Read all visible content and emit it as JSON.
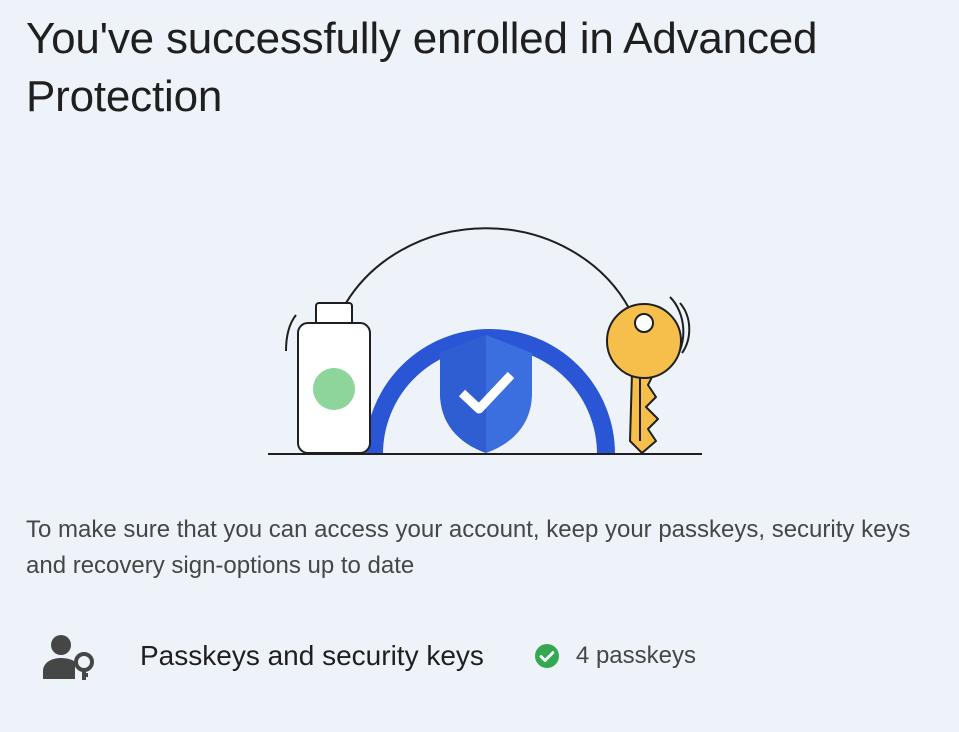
{
  "page": {
    "title": "You've successfully enrolled in Advanced Protection",
    "description": "To make sure that you can access your account, keep your passkeys, security keys and recovery sign-options up to date"
  },
  "illustration": {
    "icon": "advanced-protection-illustration",
    "colors": {
      "ring": "#2a56d6",
      "shield": "#3b6fe0",
      "device_dot": "#8ed59c",
      "key": "#f6bf4b"
    }
  },
  "passkeys_row": {
    "icon": "person-key-icon",
    "label": "Passkeys and security keys",
    "status_icon": "check-circle-icon",
    "status_text": "4 passkeys",
    "status_color": "#34a853"
  }
}
